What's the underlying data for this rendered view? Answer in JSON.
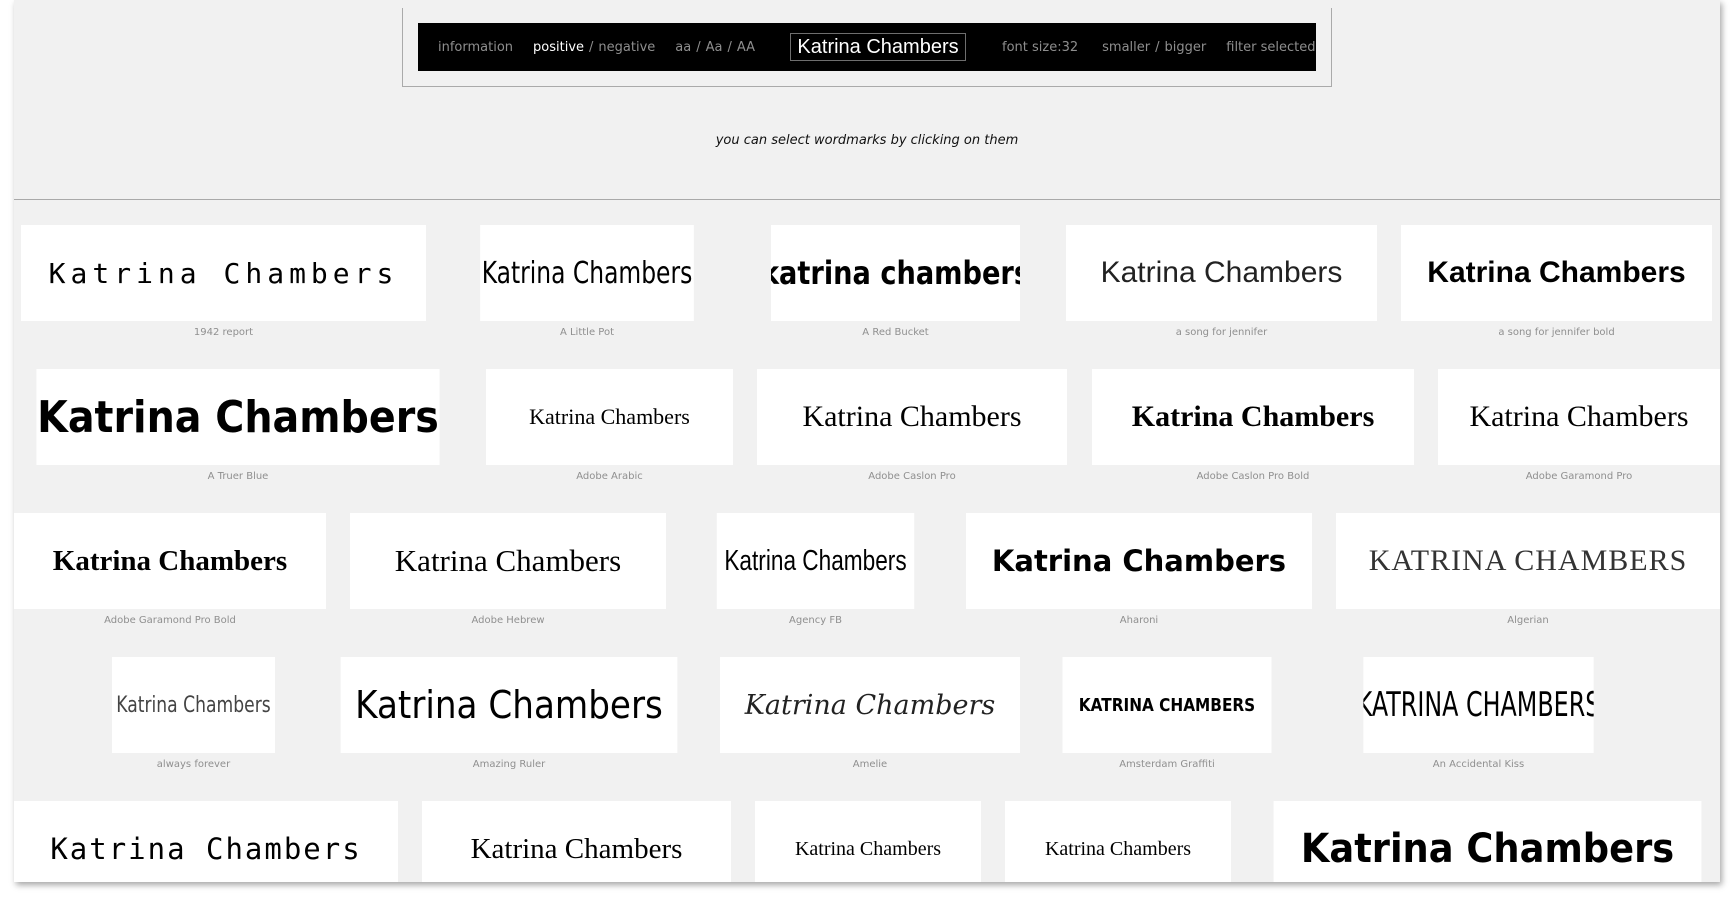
{
  "toolbar": {
    "information": "information",
    "positive": "positive",
    "slash": "/",
    "negative": "negative",
    "case_lower": "aa",
    "case_title": "Aa",
    "case_upper": "AA",
    "wordmark_value": "Katrina Chambers",
    "font_size_label": "font size:",
    "font_size_value": "32",
    "smaller": "smaller",
    "bigger": "bigger",
    "filter": "filter selected"
  },
  "hint": "you can select wordmarks by clicking on them",
  "sample_text": "Katrina Chambers",
  "fonts": [
    "1942 report",
    "A Little Pot",
    "A Red Bucket",
    "a song for jennifer",
    "a song for jennifer bold",
    "A Truer Blue",
    "Adobe Arabic",
    "Adobe Caslon Pro",
    "Adobe Caslon Pro Bold",
    "Adobe Garamond Pro",
    "Adobe Garamond Pro Bold",
    "Adobe Hebrew",
    "Agency FB",
    "Aharoni",
    "Algerian",
    "always forever",
    "Amazing Ruler",
    "Amelie",
    "Amsterdam Graffiti",
    "An Accidental Kiss",
    "",
    "",
    "",
    "",
    ""
  ]
}
